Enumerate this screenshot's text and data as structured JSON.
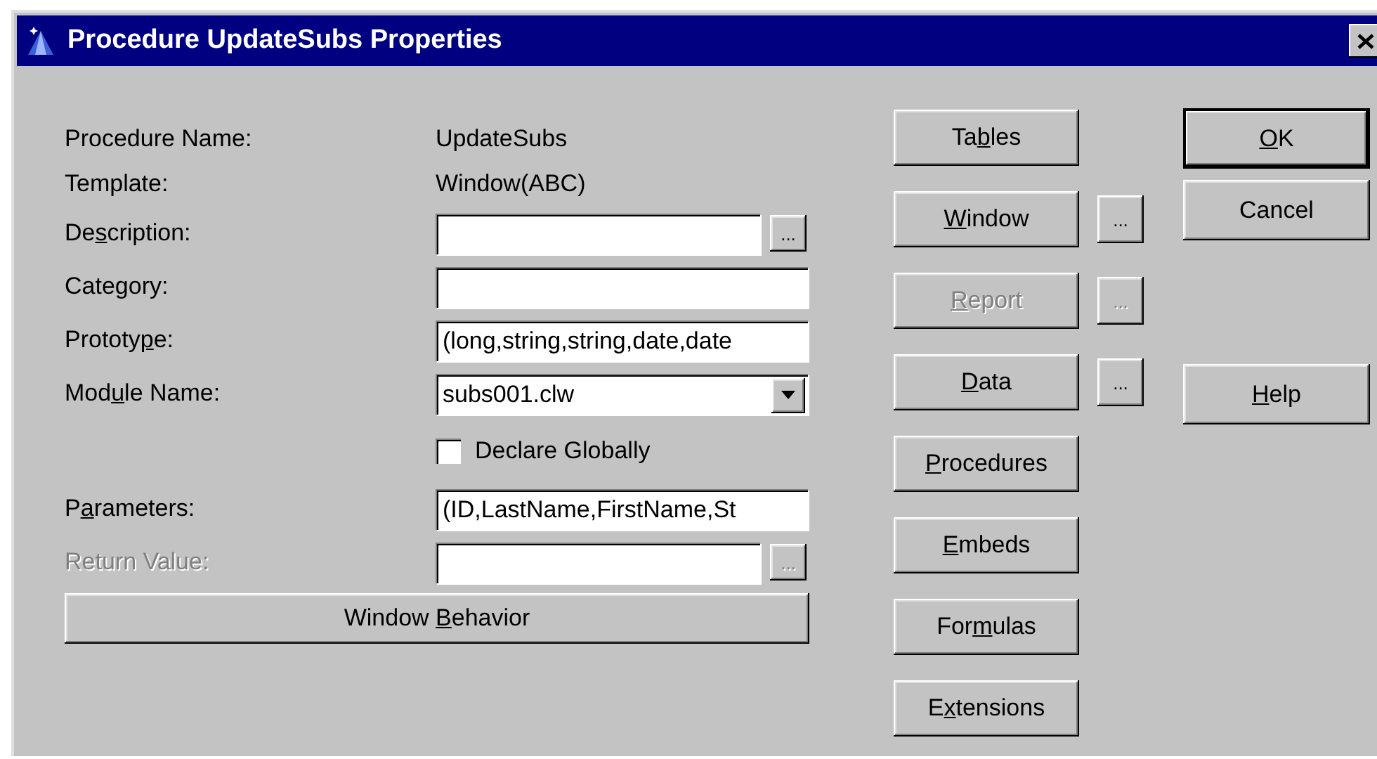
{
  "window": {
    "title": "Procedure UpdateSubs Properties"
  },
  "fields": [
    {
      "kind": "static",
      "label": {
        "pre": "Procedure Name:"
      },
      "value": "UpdateSubs"
    },
    {
      "kind": "static",
      "label": {
        "pre": "Template:"
      },
      "value": "Window(ABC)"
    },
    {
      "kind": "text",
      "label": {
        "pre": "De",
        "key": "s",
        "post": "cription:"
      },
      "ellipsis": {
        "label": "...",
        "disabled": false
      }
    },
    {
      "kind": "text",
      "label": {
        "pre": "Category:"
      }
    },
    {
      "kind": "text",
      "label": {
        "pre": "Prototy",
        "key": "p",
        "post": "e:"
      },
      "value": "(long,string,string,date,date"
    },
    {
      "kind": "combo",
      "label": {
        "pre": "Mod",
        "key": "u",
        "post": "le Name:"
      },
      "value": "subs001.clw"
    },
    {
      "kind": "checkbox",
      "label": {
        "pre": "Declare Globally"
      },
      "checked": false
    },
    {
      "kind": "text",
      "label": {
        "pre": "P",
        "key": "a",
        "post": "rameters:"
      },
      "value": "(ID,LastName,FirstName,St"
    },
    {
      "kind": "text",
      "label": {
        "pre": "Return Value:"
      },
      "disabled": true,
      "ellipsis": {
        "label": "...",
        "disabled": true
      }
    }
  ],
  "behavior_button": {
    "label": {
      "pre": "Window ",
      "key": "B",
      "post": "ehavior"
    }
  },
  "tool_buttons": [
    {
      "label": {
        "pre": "Ta",
        "key": "b",
        "post": "les"
      },
      "disabled": false
    },
    {
      "label": {
        "key": "W",
        "post": "indow"
      },
      "disabled": false,
      "ellipsis": {
        "label": "...",
        "disabled": false
      }
    },
    {
      "label": {
        "key": "R",
        "post": "eport"
      },
      "disabled": true,
      "ellipsis": {
        "label": "...",
        "disabled": true
      }
    },
    {
      "label": {
        "key": "D",
        "post": "ata"
      },
      "disabled": false,
      "ellipsis": {
        "label": "...",
        "disabled": false
      }
    },
    {
      "label": {
        "key": "P",
        "post": "rocedures"
      },
      "disabled": false
    },
    {
      "label": {
        "key": "E",
        "post": "mbeds"
      },
      "disabled": false
    },
    {
      "label": {
        "pre": "For",
        "key": "m",
        "post": "ulas"
      },
      "disabled": false
    },
    {
      "label": {
        "pre": "E",
        "key": "x",
        "post": "tensions"
      },
      "disabled": false
    }
  ],
  "dialog_buttons": [
    {
      "label": {
        "key": "O",
        "post": "K"
      },
      "default": true
    },
    {
      "label": {
        "pre": "Cancel"
      },
      "default": false
    },
    {
      "label": {
        "key": "H",
        "post": "elp"
      },
      "default": false
    }
  ]
}
